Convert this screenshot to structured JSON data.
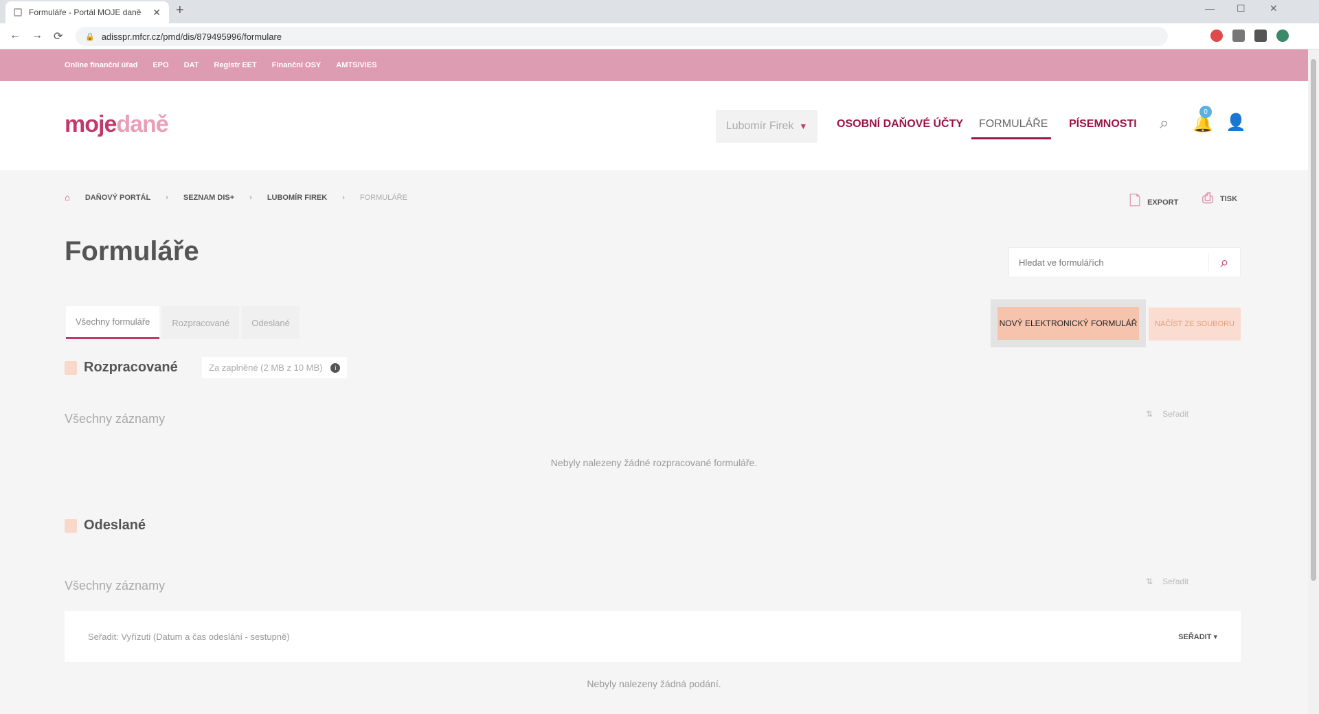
{
  "browser": {
    "tab_title": "Formuláře - Portál MOJE daně",
    "address": "adisspr.mfcr.cz/pmd/dis/879495996/formulare",
    "back_glyph": "←",
    "forward_glyph": "→",
    "reload_glyph": "⟳",
    "lock_glyph": "🔒",
    "close_glyph": "✕",
    "newtab_glyph": "+",
    "minimize_glyph": "—",
    "maximize_glyph": "☐",
    "win_close_glyph": "✕"
  },
  "topstrip": {
    "links": [
      "Online finanční úřad",
      "EPO",
      "DAT",
      "Registr EET",
      "Finanční OSY",
      "AMTS/VIES"
    ]
  },
  "header": {
    "logo_moje": "moje",
    "logo_dane": "daně",
    "profile": "Lubomír Firek",
    "nav": {
      "accounts": "OSOBNÍ DAŇOVÉ ÚČTY",
      "forms": "FORMULÁŘE",
      "documents": "PÍSEMNOSTI"
    },
    "notification_count": "0"
  },
  "breadcrumb": {
    "items": [
      "DAŇOVÝ PORTÁL",
      "SEZNAM DIS+",
      "LUBOMÍR FIREK"
    ],
    "current": "FORMULÁŘE",
    "sep": "›"
  },
  "utility": {
    "export": "EXPORT",
    "print": "TISK"
  },
  "page": {
    "title": "Formuláře",
    "search_placeholder": "Hledat ve formulářích"
  },
  "tabs": [
    "Všechny formuláře",
    "Rozpracované",
    "Odeslané"
  ],
  "actions": {
    "new_form": "NOVÝ ELEKTRONICKÝ FORMULÁŘ",
    "load_file": "NAČÍST ZE SOUBORU"
  },
  "drafts": {
    "title": "Rozpracované",
    "period": "Za zaplněné (2 MB z 10 MB)",
    "info_glyph": "i",
    "all_records": "Všechny záznamy",
    "sort": "Seřadit",
    "empty": "Nebyly nalezeny žádné rozpracované formuláře."
  },
  "sent": {
    "title": "Odeslané",
    "all_records": "Všechny záznamy",
    "sort": "Seřadit",
    "filter": "Seřadit: Vyřízuti (Datum a čas odeslání - sestupně)",
    "filter_sort": "SEŘADIT ▾",
    "empty": "Nebyly nalezeny žádná podání."
  },
  "colors": {
    "brand": "#9b1445",
    "strip": "#de9cb3",
    "button": "#f6c3ad"
  }
}
